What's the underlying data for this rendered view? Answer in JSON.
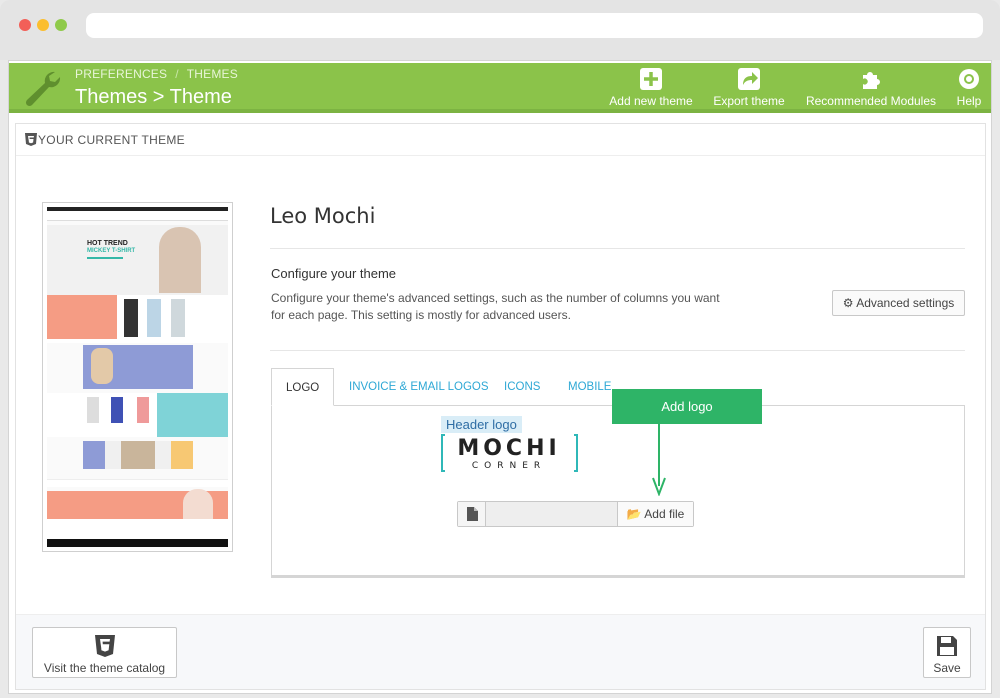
{
  "header": {
    "breadcrumb": [
      "PREFERENCES",
      "THEMES"
    ],
    "breadcrumb_sep": "/",
    "title": "Themes > Theme",
    "actions": [
      {
        "label": "Add new theme",
        "icon": "plus-square-icon"
      },
      {
        "label": "Export theme",
        "icon": "share-icon"
      },
      {
        "label": "Recommended Modules",
        "icon": "puzzle-icon"
      },
      {
        "label": "Help",
        "icon": "lifebuoy-icon"
      }
    ]
  },
  "panel": {
    "heading": "YOUR CURRENT THEME",
    "theme_name": "Leo Mochi",
    "configure_title": "Configure your theme",
    "configure_desc": "Configure your theme's advanced settings, such as the number of columns you want for each page. This setting is mostly for advanced users.",
    "advanced_button": "Advanced settings",
    "thumbnail": {
      "hero_line1": "HOT TREND",
      "hero_line2": "MICKEY T-SHIRT"
    }
  },
  "tabs": [
    {
      "label": "LOGO",
      "active": true
    },
    {
      "label": "INVOICE & EMAIL LOGOS",
      "active": false
    },
    {
      "label": "ICONS",
      "active": false
    },
    {
      "label": "MOBILE",
      "active": false
    }
  ],
  "logo_tab": {
    "header_logo_label": "Header logo",
    "logo_word": "MOCHI",
    "logo_sub": "CORNER",
    "add_logo_callout": "Add logo",
    "add_file_button": "Add file",
    "file_value": ""
  },
  "footer": {
    "catalog_button": "Visit the theme catalog",
    "save_button": "Save"
  },
  "colors": {
    "header_green": "#8bc34a",
    "link_blue": "#2ea8d5",
    "callout_green": "#2eb467"
  }
}
